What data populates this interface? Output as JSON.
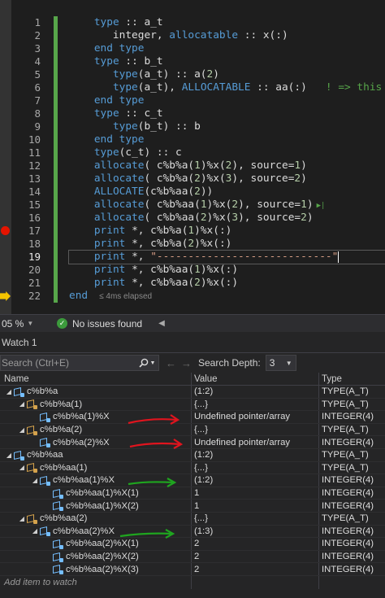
{
  "editor": {
    "line_numbers": [
      "1",
      "2",
      "3",
      "4",
      "5",
      "6",
      "7",
      "8",
      "9",
      "10",
      "11",
      "12",
      "13",
      "14",
      "15",
      "16",
      "17",
      "18",
      "19",
      "20",
      "21",
      "22"
    ],
    "elapsed": "≤ 4ms elapsed",
    "lines": [
      [
        [
          "    ",
          ""
        ],
        [
          "type",
          "kw"
        ],
        [
          " :: a_t",
          ""
        ]
      ],
      [
        [
          "       integer, ",
          ""
        ],
        [
          "allocatable",
          "kw"
        ],
        [
          " :: x(:)",
          ""
        ]
      ],
      [
        [
          "    ",
          ""
        ],
        [
          "end type",
          "kw"
        ]
      ],
      [
        [
          "    ",
          ""
        ],
        [
          "type",
          "kw"
        ],
        [
          " :: b_t",
          ""
        ]
      ],
      [
        [
          "       ",
          ""
        ],
        [
          "type",
          "kw"
        ],
        [
          "(a_t) :: a(",
          ""
        ],
        [
          "2",
          "num"
        ],
        [
          ")",
          ""
        ]
      ],
      [
        [
          "       ",
          ""
        ],
        [
          "type",
          "kw"
        ],
        [
          "(a_t), ",
          ""
        ],
        [
          "ALLOCATABLE",
          "kw"
        ],
        [
          " :: aa(:)   ",
          ""
        ],
        [
          "! => this is fi",
          "cm"
        ]
      ],
      [
        [
          "    ",
          ""
        ],
        [
          "end type",
          "kw"
        ]
      ],
      [
        [
          "    ",
          ""
        ],
        [
          "type",
          "kw"
        ],
        [
          " :: c_t",
          ""
        ]
      ],
      [
        [
          "       ",
          ""
        ],
        [
          "type",
          "kw"
        ],
        [
          "(b_t) :: b",
          ""
        ]
      ],
      [
        [
          "    ",
          ""
        ],
        [
          "end type",
          "kw"
        ]
      ],
      [
        [
          "    ",
          ""
        ],
        [
          "type",
          "kw"
        ],
        [
          "(c_t) :: c",
          ""
        ]
      ],
      [
        [
          "    ",
          ""
        ],
        [
          "allocate",
          "kw"
        ],
        [
          "( c%b%a(",
          ""
        ],
        [
          "1",
          "num"
        ],
        [
          ")%x(",
          ""
        ],
        [
          "2",
          "num"
        ],
        [
          "), source=",
          ""
        ],
        [
          "1",
          "num"
        ],
        [
          ")",
          ""
        ]
      ],
      [
        [
          "    ",
          ""
        ],
        [
          "allocate",
          "kw"
        ],
        [
          "( c%b%a(",
          ""
        ],
        [
          "2",
          "num"
        ],
        [
          ")%x(",
          ""
        ],
        [
          "3",
          "num"
        ],
        [
          "), source=",
          ""
        ],
        [
          "2",
          "num"
        ],
        [
          ")",
          ""
        ]
      ],
      [
        [
          "    ",
          ""
        ],
        [
          "ALLOCATE",
          "kw"
        ],
        [
          "(c%b%aa(",
          ""
        ],
        [
          "2",
          "num"
        ],
        [
          "))",
          ""
        ]
      ],
      [
        [
          "    ",
          ""
        ],
        [
          "allocate",
          "kw"
        ],
        [
          "( c%b%aa(",
          ""
        ],
        [
          "1",
          "num"
        ],
        [
          ")%x(",
          ""
        ],
        [
          "2",
          "num"
        ],
        [
          "), source=",
          ""
        ],
        [
          "1",
          "num"
        ],
        [
          ")",
          ""
        ]
      ],
      [
        [
          "    ",
          ""
        ],
        [
          "allocate",
          "kw"
        ],
        [
          "( c%b%aa(",
          ""
        ],
        [
          "2",
          "num"
        ],
        [
          ")%x(",
          ""
        ],
        [
          "3",
          "num"
        ],
        [
          "), source=",
          ""
        ],
        [
          "2",
          "num"
        ],
        [
          ")",
          ""
        ]
      ],
      [
        [
          "    ",
          ""
        ],
        [
          "print",
          "kw"
        ],
        [
          " *, c%b%a(",
          ""
        ],
        [
          "1",
          "num"
        ],
        [
          ")%x(:)",
          ""
        ]
      ],
      [
        [
          "    ",
          ""
        ],
        [
          "print",
          "kw"
        ],
        [
          " *, c%b%a(",
          ""
        ],
        [
          "2",
          "num"
        ],
        [
          ")%x(:)",
          ""
        ]
      ],
      [
        [
          "    ",
          ""
        ],
        [
          "print",
          "kw"
        ],
        [
          " *, ",
          ""
        ],
        [
          "\"----------------------------\"",
          "str"
        ]
      ],
      [
        [
          "    ",
          ""
        ],
        [
          "print",
          "kw"
        ],
        [
          " *, c%b%aa(",
          ""
        ],
        [
          "1",
          "num"
        ],
        [
          ")%x(:)",
          ""
        ]
      ],
      [
        [
          "    ",
          ""
        ],
        [
          "print",
          "kw"
        ],
        [
          " *, c%b%aa(",
          ""
        ],
        [
          "2",
          "num"
        ],
        [
          ")%x(:)",
          ""
        ]
      ],
      [
        [
          "",
          ""
        ],
        [
          "end",
          "kw"
        ]
      ]
    ]
  },
  "statusbar": {
    "zoom": "05 %",
    "issues": "No issues found"
  },
  "watch": {
    "title": "Watch 1",
    "search_placeholder": "Search (Ctrl+E)",
    "depth_label": "Search Depth:",
    "depth_value": "3",
    "columns": {
      "name": "Name",
      "value": "Value",
      "type": "Type"
    },
    "add_item": "Add item to watch",
    "rows": [
      {
        "name": "c%b%a",
        "value": "(1:2)",
        "type": "TYPE(A_T)",
        "level": 0,
        "exp": "open",
        "icon": "object"
      },
      {
        "name": "c%b%a(1)",
        "value": "{...}",
        "type": "TYPE(A_T)",
        "level": 1,
        "exp": "open",
        "icon": "lock"
      },
      {
        "name": "c%b%a(1)%X",
        "value": "Undefined pointer/array",
        "type": "INTEGER(4)",
        "level": 2,
        "exp": "none",
        "icon": "object"
      },
      {
        "name": "c%b%a(2)",
        "value": "{...}",
        "type": "TYPE(A_T)",
        "level": 1,
        "exp": "open",
        "icon": "lock"
      },
      {
        "name": "c%b%a(2)%X",
        "value": "Undefined pointer/array",
        "type": "INTEGER(4)",
        "level": 2,
        "exp": "none",
        "icon": "object"
      },
      {
        "name": "c%b%aa",
        "value": "(1:2)",
        "type": "TYPE(A_T)",
        "level": 0,
        "exp": "open",
        "icon": "object"
      },
      {
        "name": "c%b%aa(1)",
        "value": "{...}",
        "type": "TYPE(A_T)",
        "level": 1,
        "exp": "open",
        "icon": "lock"
      },
      {
        "name": "c%b%aa(1)%X",
        "value": "(1:2)",
        "type": "INTEGER(4)",
        "level": 2,
        "exp": "open",
        "icon": "object"
      },
      {
        "name": "c%b%aa(1)%X(1)",
        "value": "1",
        "type": "INTEGER(4)",
        "level": 3,
        "exp": "none",
        "icon": "object"
      },
      {
        "name": "c%b%aa(1)%X(2)",
        "value": "1",
        "type": "INTEGER(4)",
        "level": 3,
        "exp": "none",
        "icon": "object"
      },
      {
        "name": "c%b%aa(2)",
        "value": "{...}",
        "type": "TYPE(A_T)",
        "level": 1,
        "exp": "open",
        "icon": "lock"
      },
      {
        "name": "c%b%aa(2)%X",
        "value": "(1:3)",
        "type": "INTEGER(4)",
        "level": 2,
        "exp": "open",
        "icon": "object"
      },
      {
        "name": "c%b%aa(2)%X(1)",
        "value": "2",
        "type": "INTEGER(4)",
        "level": 3,
        "exp": "none",
        "icon": "object"
      },
      {
        "name": "c%b%aa(2)%X(2)",
        "value": "2",
        "type": "INTEGER(4)",
        "level": 3,
        "exp": "none",
        "icon": "object"
      },
      {
        "name": "c%b%aa(2)%X(3)",
        "value": "2",
        "type": "INTEGER(4)",
        "level": 3,
        "exp": "none",
        "icon": "object"
      }
    ]
  },
  "colors": {
    "keyword": "#569cd6",
    "comment": "#57a64a",
    "string": "#d69d85",
    "breakpoint": "#e51400",
    "arrow_red": "#e0141e",
    "arrow_green": "#1fa51f"
  }
}
